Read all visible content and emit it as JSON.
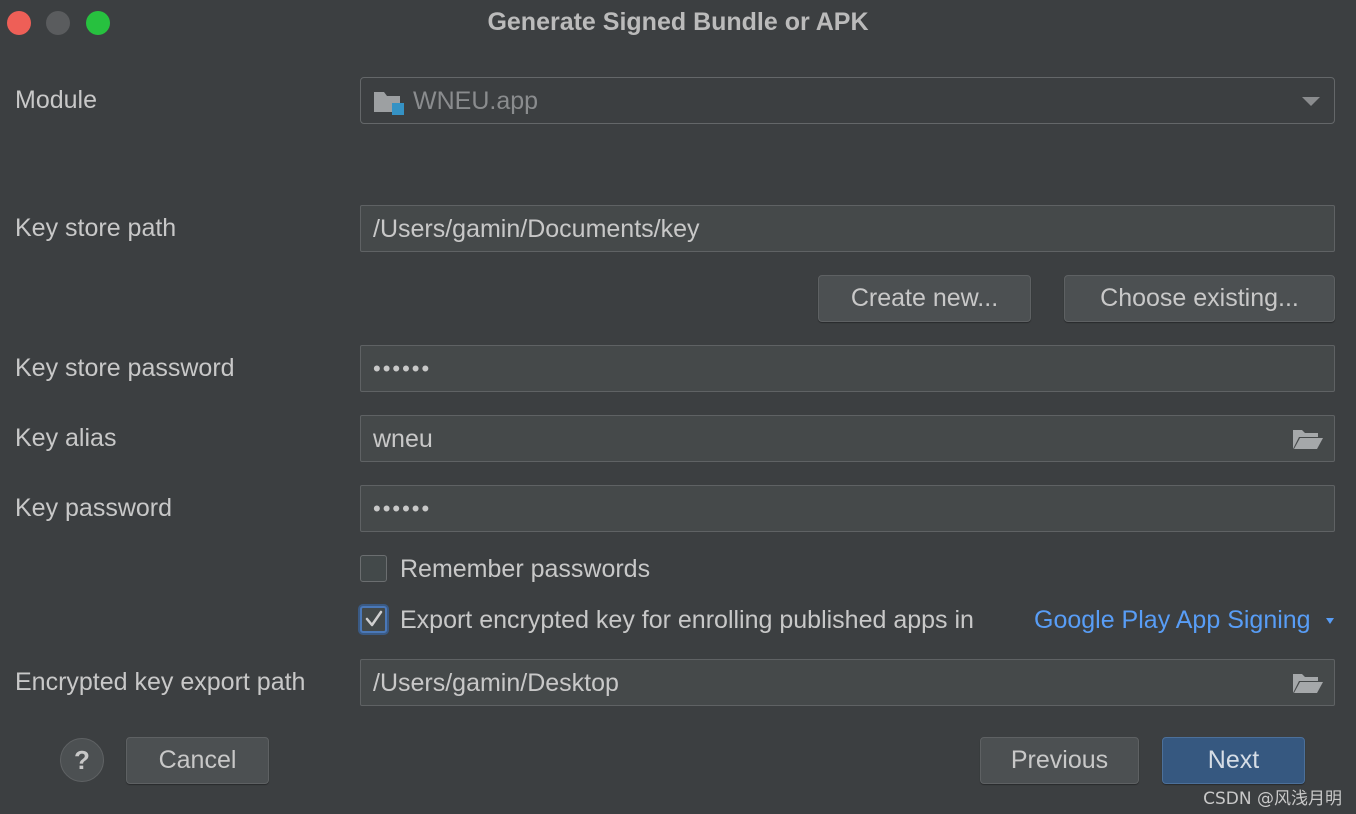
{
  "window": {
    "title": "Generate Signed Bundle or APK"
  },
  "module": {
    "label": "Module",
    "value": "WNEU.app"
  },
  "key_store_path": {
    "label": "Key store path",
    "value": "/Users/gamin/Documents/key"
  },
  "key_store_buttons": {
    "create_new": "Create new...",
    "choose_existing": "Choose existing..."
  },
  "key_store_password": {
    "label": "Key store password",
    "value": "••••••"
  },
  "key_alias": {
    "label": "Key alias",
    "value": "wneu"
  },
  "key_password": {
    "label": "Key password",
    "value": "••••••"
  },
  "remember_passwords": {
    "label": "Remember passwords",
    "checked": false
  },
  "export_encrypted": {
    "label": "Export encrypted key for enrolling published apps in",
    "link": "Google Play App Signing",
    "checked": true
  },
  "encrypted_key_export_path": {
    "label": "Encrypted key export path",
    "value": "/Users/gamin/Desktop"
  },
  "footer": {
    "help": "?",
    "cancel": "Cancel",
    "previous": "Previous",
    "next": "Next"
  },
  "watermark": "CSDN @风浅月明",
  "icons": {
    "module": "module-folder-icon",
    "dropdown": "chevron-down-icon",
    "browse": "folder-open-icon",
    "check": "checkmark-icon"
  },
  "colors": {
    "background": "#3c3f41",
    "field_background": "#45494a",
    "primary_button": "#365880",
    "link": "#589df6"
  }
}
